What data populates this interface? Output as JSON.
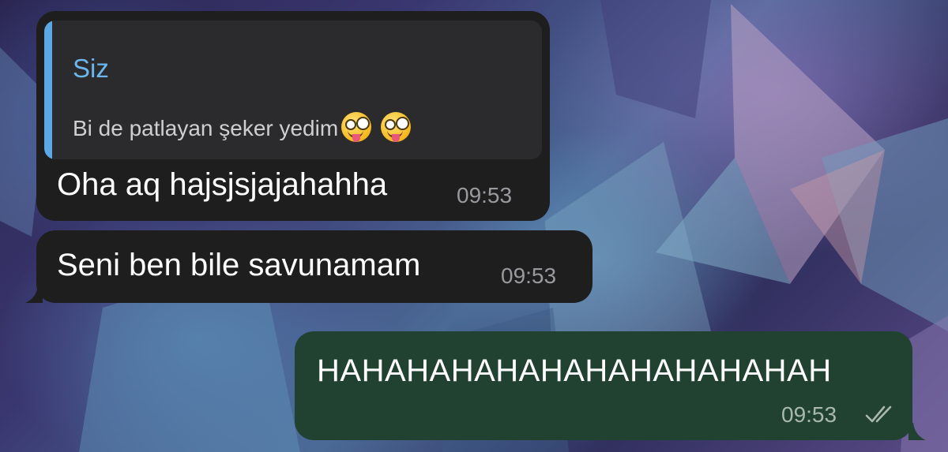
{
  "chat": {
    "messages": [
      {
        "direction": "incoming",
        "reply": {
          "sender": "Siz",
          "text": "Bi de patlayan şeker yedim",
          "emojis": [
            "zany-face-emoji",
            "zany-face-emoji"
          ]
        },
        "text": "Oha aq hajsjsjajahahha",
        "time": "09:53"
      },
      {
        "direction": "incoming",
        "text": "Seni ben bile savunamam",
        "time": "09:53"
      },
      {
        "direction": "outgoing",
        "text": "HAHAHAHAHAHAHAHAHAHAHAH",
        "time": "09:53",
        "status": "double-check-read-icon"
      }
    ]
  },
  "colors": {
    "incoming_bubble": "#1e1e1f",
    "outgoing_bubble": "#214231",
    "reply_accent": "#5aa8e6",
    "reply_sender": "#6cb6f0",
    "timestamp": "#9a9a9e"
  }
}
